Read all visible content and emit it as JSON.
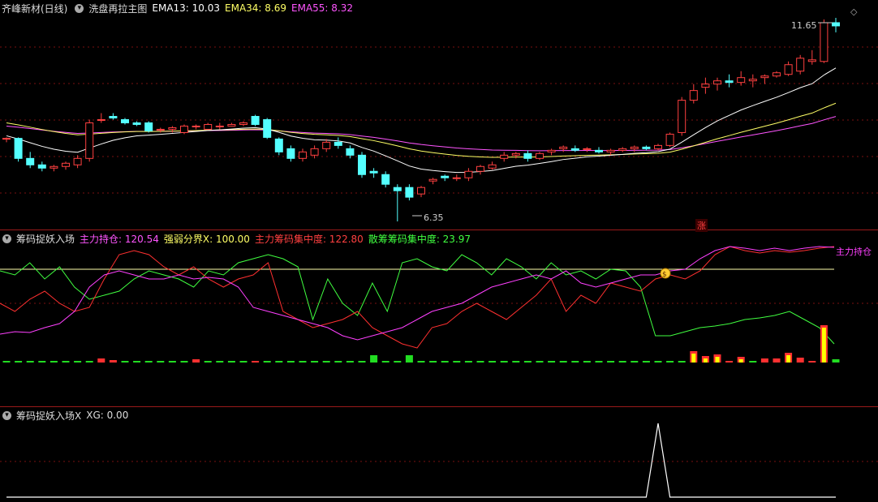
{
  "colors": {
    "up": "#ff4040",
    "down": "#54ffff",
    "ema13": "#ffffff",
    "ema34": "#ffff66",
    "ema55": "#ff55ff",
    "grid": "#7a1010",
    "red_line": "#ff3030",
    "magenta_line": "#ff40ff",
    "green_line": "#40ff40",
    "threshold": "#ffffaa"
  },
  "price_panel": {
    "stock_name": "齐峰新材(日线)",
    "indicator_name": "洗盘再拉主图",
    "ema13": "EMA13: 10.03",
    "ema34": "EMA34: 8.69",
    "ema55": "EMA55: 8.32",
    "high_label": "11.65",
    "low_label": "6.35",
    "zhang_badge": "涨",
    "diamond_icon": "◇"
  },
  "chip_panel": {
    "name": "筹码捉妖入场",
    "main_hold": "主力持仓: 120.54",
    "strength": "强弱分界X: 100.00",
    "main_conc": "主力筹码集中度: 122.80",
    "retail_conc": "散筹筹码集中度: 23.97",
    "right_label": "主力持仓",
    "threshold": 100
  },
  "xg_panel": {
    "name": "筹码捉妖入场X",
    "xg": "XG: 0.00"
  },
  "chart_data": {
    "type": "candlestick",
    "candles": [
      [
        8.9,
        8.95,
        8.8,
        8.92
      ],
      [
        8.92,
        8.95,
        8.2,
        8.3
      ],
      [
        8.3,
        8.5,
        8.0,
        8.1
      ],
      [
        8.1,
        8.2,
        7.9,
        8.0
      ],
      [
        8.0,
        8.1,
        7.9,
        8.05
      ],
      [
        8.05,
        8.2,
        7.95,
        8.15
      ],
      [
        8.1,
        8.4,
        8.0,
        8.3
      ],
      [
        8.3,
        9.5,
        8.2,
        9.4
      ],
      [
        9.5,
        9.7,
        9.4,
        9.5
      ],
      [
        9.6,
        9.7,
        9.5,
        9.55
      ],
      [
        9.5,
        9.55,
        9.35,
        9.4
      ],
      [
        9.4,
        9.45,
        9.3,
        9.35
      ],
      [
        9.4,
        9.45,
        9.1,
        9.15
      ],
      [
        9.2,
        9.25,
        9.1,
        9.2
      ],
      [
        9.2,
        9.3,
        9.1,
        9.25
      ],
      [
        9.1,
        9.35,
        9.05,
        9.3
      ],
      [
        9.3,
        9.35,
        9.2,
        9.3
      ],
      [
        9.2,
        9.4,
        9.2,
        9.35
      ],
      [
        9.3,
        9.4,
        9.2,
        9.3
      ],
      [
        9.3,
        9.4,
        9.3,
        9.35
      ],
      [
        9.35,
        9.45,
        9.3,
        9.4
      ],
      [
        9.6,
        9.65,
        9.3,
        9.35
      ],
      [
        9.5,
        9.55,
        8.9,
        8.95
      ],
      [
        8.9,
        8.95,
        8.4,
        8.5
      ],
      [
        8.6,
        8.7,
        8.2,
        8.3
      ],
      [
        8.3,
        8.6,
        8.2,
        8.5
      ],
      [
        8.4,
        8.7,
        8.3,
        8.6
      ],
      [
        8.6,
        8.9,
        8.5,
        8.8
      ],
      [
        8.8,
        8.95,
        8.6,
        8.7
      ],
      [
        8.6,
        8.7,
        8.3,
        8.4
      ],
      [
        8.4,
        8.5,
        7.7,
        7.8
      ],
      [
        7.9,
        8.0,
        7.7,
        7.85
      ],
      [
        7.8,
        7.9,
        7.4,
        7.5
      ],
      [
        7.4,
        7.5,
        6.35,
        7.3
      ],
      [
        7.4,
        7.5,
        7.0,
        7.1
      ],
      [
        7.2,
        7.45,
        7.1,
        7.4
      ],
      [
        7.6,
        7.7,
        7.5,
        7.65
      ],
      [
        7.75,
        7.8,
        7.6,
        7.7
      ],
      [
        7.7,
        7.8,
        7.6,
        7.7
      ],
      [
        7.7,
        8.0,
        7.6,
        7.9
      ],
      [
        7.9,
        8.1,
        7.8,
        8.05
      ],
      [
        8.0,
        8.2,
        7.95,
        8.1
      ],
      [
        8.3,
        8.5,
        8.2,
        8.4
      ],
      [
        8.4,
        8.5,
        8.3,
        8.45
      ],
      [
        8.45,
        8.55,
        8.2,
        8.3
      ],
      [
        8.3,
        8.5,
        8.25,
        8.45
      ],
      [
        8.5,
        8.6,
        8.4,
        8.55
      ],
      [
        8.6,
        8.7,
        8.5,
        8.65
      ],
      [
        8.6,
        8.7,
        8.5,
        8.55
      ],
      [
        8.6,
        8.65,
        8.5,
        8.6
      ],
      [
        8.55,
        8.65,
        8.45,
        8.5
      ],
      [
        8.5,
        8.6,
        8.4,
        8.55
      ],
      [
        8.55,
        8.65,
        8.5,
        8.6
      ],
      [
        8.6,
        8.7,
        8.5,
        8.65
      ],
      [
        8.65,
        8.7,
        8.55,
        8.6
      ],
      [
        8.6,
        8.75,
        8.55,
        8.7
      ],
      [
        8.7,
        9.1,
        8.65,
        9.05
      ],
      [
        9.1,
        10.2,
        9.0,
        10.1
      ],
      [
        10.1,
        10.6,
        10.0,
        10.4
      ],
      [
        10.5,
        10.8,
        10.3,
        10.6
      ],
      [
        10.6,
        10.8,
        10.4,
        10.7
      ],
      [
        10.7,
        10.9,
        10.5,
        10.65
      ],
      [
        10.65,
        11.0,
        10.55,
        10.8
      ],
      [
        10.7,
        10.9,
        10.5,
        10.75
      ],
      [
        10.8,
        10.9,
        10.6,
        10.85
      ],
      [
        10.85,
        11.0,
        10.8,
        10.95
      ],
      [
        10.9,
        11.3,
        10.85,
        11.2
      ],
      [
        11.0,
        11.5,
        10.9,
        11.4
      ],
      [
        11.3,
        11.65,
        11.2,
        11.35
      ],
      [
        11.3,
        12.6,
        11.25,
        12.5
      ],
      [
        12.5,
        12.65,
        12.2,
        12.4
      ]
    ],
    "price_ylim": [
      6.2,
      12.8
    ],
    "xg_series": [
      0,
      0,
      0,
      0,
      0,
      0,
      0,
      0,
      0,
      0,
      0,
      0,
      0,
      0,
      0,
      0,
      0,
      0,
      0,
      0,
      0,
      0,
      0,
      0,
      0,
      0,
      0,
      0,
      0,
      0,
      0,
      0,
      0,
      0,
      0,
      0,
      0,
      0,
      0,
      0,
      0,
      0,
      0,
      0,
      0,
      0,
      0,
      0,
      0,
      0,
      0,
      0,
      0,
      0,
      0,
      1,
      0,
      0,
      0,
      0,
      0,
      0,
      0,
      0,
      0,
      0,
      0,
      0,
      0,
      0,
      0
    ]
  }
}
